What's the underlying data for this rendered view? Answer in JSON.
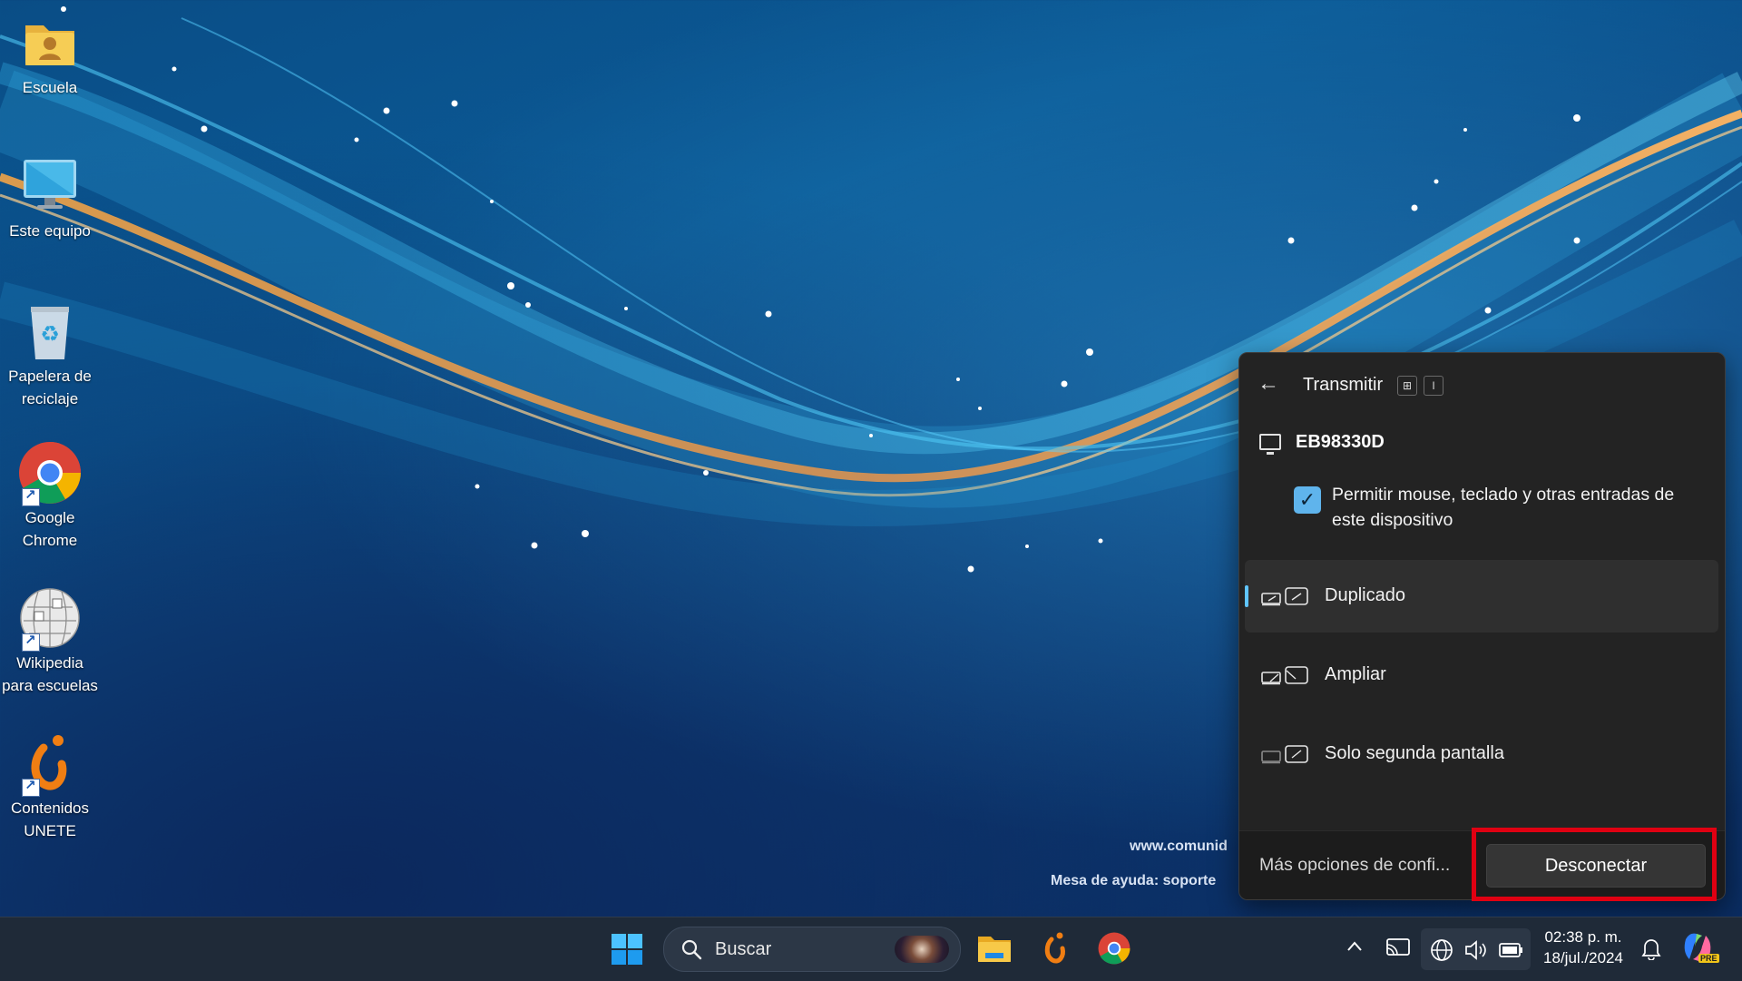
{
  "desktop": {
    "icons": [
      {
        "label": "Escuela",
        "icon": "user-folder-icon"
      },
      {
        "label": "Este equipo",
        "icon": "monitor-icon"
      },
      {
        "label": "Papelera de reciclaje",
        "icon": "recycle-bin-icon"
      },
      {
        "label": "Google Chrome",
        "icon": "chrome-icon"
      },
      {
        "label": "Wikipedia para escuelas",
        "icon": "wikipedia-globe-icon"
      },
      {
        "label": "Contenidos UNETE",
        "icon": "unete-logo-icon"
      }
    ],
    "wallpaper_text": {
      "line1": "www.comunid",
      "line2": "Mesa de ayuda: soporte"
    }
  },
  "cast_panel": {
    "title": "Transmitir",
    "shortcut_keys": [
      "⊞",
      "I"
    ],
    "device_name": "EB98330D",
    "allow_input_label": "Permitir mouse, teclado y otras entradas de este dispositivo",
    "allow_input_checked": true,
    "modes": [
      {
        "label": "Duplicado",
        "selected": true,
        "icon": "duplicate-display-icon"
      },
      {
        "label": "Ampliar",
        "selected": false,
        "icon": "extend-display-icon"
      },
      {
        "label": "Solo segunda pantalla",
        "selected": false,
        "icon": "second-screen-only-icon"
      }
    ],
    "more_options": "Más opciones de confi...",
    "disconnect_label": "Desconectar",
    "accent_color": "#60c5ff",
    "highlight_color": "#e00012"
  },
  "taskbar": {
    "search_placeholder": "Buscar",
    "apps": [
      "start-icon",
      "file-explorer-icon",
      "unete-icon",
      "chrome-icon"
    ],
    "tray": {
      "time": "02:38 p. m.",
      "date": "18/jul./2024",
      "icons": [
        "chevron-up-icon",
        "cast-icon",
        "network-icon",
        "volume-icon",
        "battery-icon",
        "notification-icon",
        "copilot-icon"
      ],
      "copilot_badge": "PRE"
    }
  }
}
